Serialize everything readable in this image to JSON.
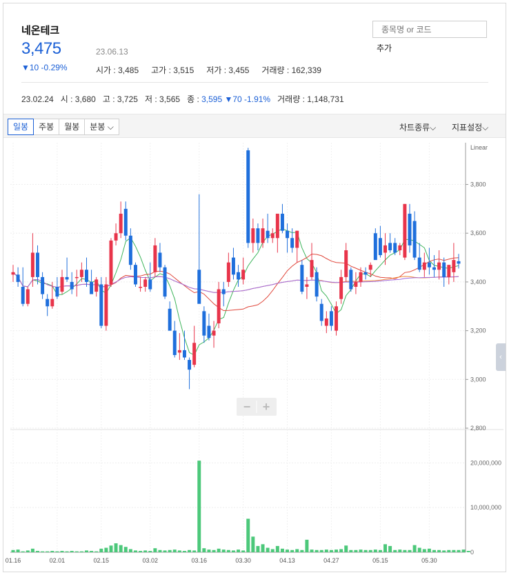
{
  "stock": {
    "name": "네온테크",
    "price": "3,475",
    "change": "▼10 -0.29%",
    "date": "23.06.13",
    "open_label": "시가",
    "open": "3,485",
    "high_label": "고가",
    "high": "3,515",
    "low_label": "저가",
    "low": "3,455",
    "volume_label": "거래량",
    "volume": "162,339"
  },
  "search": {
    "placeholder": "종목명 or 코드",
    "add_label": "추가"
  },
  "prev_day": {
    "date": "23.02.24",
    "open_label": "시",
    "open": "3,680",
    "high_label": "고",
    "high": "3,725",
    "low_label": "저",
    "low": "3,565",
    "close_label": "종",
    "close": "3,595",
    "change": "▼70 -1.91%",
    "volume_label": "거래량",
    "volume": "1,148,731"
  },
  "toolbar": {
    "periods": [
      "일봉",
      "주봉",
      "월봉",
      "분봉"
    ],
    "active_period": "일봉",
    "chart_type_label": "차트종류",
    "indicator_label": "지표설정"
  },
  "colors": {
    "up": "#e8344a",
    "down": "#1f6fdc",
    "ma5": "#3db45a",
    "ma20": "#e0463a",
    "ma60": "#ef8a3c",
    "ma120": "#a06ae0",
    "volume": "#4cc87a"
  },
  "chart_data": {
    "type": "candlestick",
    "scale_label": "Linear",
    "price_axis": {
      "ylim": [
        2800,
        3960
      ],
      "ticks": [
        "3,800",
        "3,600",
        "3,400",
        "3,200",
        "3,000",
        "2,800"
      ]
    },
    "volume_axis": {
      "ylim": [
        0,
        27000000
      ],
      "ticks": [
        "20,000,000",
        "10,000,000",
        "0"
      ]
    },
    "x_ticks": [
      "01.16",
      "02.01",
      "02.15",
      "03.02",
      "03.16",
      "03.30",
      "04.13",
      "04.27",
      "05.15",
      "05.30"
    ],
    "zoom_controls": [
      "−",
      "+"
    ],
    "candles": [
      {
        "o": 3430,
        "h": 3470,
        "l": 3400,
        "c": 3440
      },
      {
        "o": 3430,
        "h": 3460,
        "l": 3380,
        "c": 3400
      },
      {
        "o": 3380,
        "h": 3460,
        "l": 3300,
        "c": 3310
      },
      {
        "o": 3310,
        "h": 3380,
        "l": 3300,
        "c": 3370
      },
      {
        "o": 3420,
        "h": 3600,
        "l": 3380,
        "c": 3520
      },
      {
        "o": 3520,
        "h": 3550,
        "l": 3390,
        "c": 3420
      },
      {
        "o": 3420,
        "h": 3440,
        "l": 3330,
        "c": 3350
      },
      {
        "o": 3330,
        "h": 3350,
        "l": 3260,
        "c": 3300
      },
      {
        "o": 3300,
        "h": 3400,
        "l": 3290,
        "c": 3330
      },
      {
        "o": 3380,
        "h": 3420,
        "l": 3330,
        "c": 3340
      },
      {
        "o": 3360,
        "h": 3450,
        "l": 3350,
        "c": 3420
      },
      {
        "o": 3420,
        "h": 3500,
        "l": 3400,
        "c": 3410
      },
      {
        "o": 3400,
        "h": 3440,
        "l": 3350,
        "c": 3370
      },
      {
        "o": 3420,
        "h": 3450,
        "l": 3340,
        "c": 3420
      },
      {
        "o": 3420,
        "h": 3480,
        "l": 3400,
        "c": 3450
      },
      {
        "o": 3450,
        "h": 3500,
        "l": 3380,
        "c": 3400
      },
      {
        "o": 3400,
        "h": 3450,
        "l": 3360,
        "c": 3350
      },
      {
        "o": 3360,
        "h": 3420,
        "l": 3340,
        "c": 3410
      },
      {
        "o": 3390,
        "h": 3420,
        "l": 3210,
        "c": 3220
      },
      {
        "o": 3220,
        "h": 3420,
        "l": 3200,
        "c": 3390
      },
      {
        "o": 3390,
        "h": 3580,
        "l": 3380,
        "c": 3570
      },
      {
        "o": 3570,
        "h": 3640,
        "l": 3550,
        "c": 3600
      },
      {
        "o": 3600,
        "h": 3730,
        "l": 3580,
        "c": 3680
      },
      {
        "o": 3700,
        "h": 3730,
        "l": 3570,
        "c": 3590
      },
      {
        "o": 3590,
        "h": 3620,
        "l": 3450,
        "c": 3470
      },
      {
        "o": 3470,
        "h": 3480,
        "l": 3380,
        "c": 3390
      },
      {
        "o": 3380,
        "h": 3420,
        "l": 3360,
        "c": 3380
      },
      {
        "o": 3380,
        "h": 3420,
        "l": 3360,
        "c": 3410
      },
      {
        "o": 3410,
        "h": 3480,
        "l": 3360,
        "c": 3370
      },
      {
        "o": 3440,
        "h": 3580,
        "l": 3420,
        "c": 3550
      },
      {
        "o": 3520,
        "h": 3560,
        "l": 3440,
        "c": 3460
      },
      {
        "o": 3460,
        "h": 3470,
        "l": 3330,
        "c": 3340
      },
      {
        "o": 3290,
        "h": 3320,
        "l": 3200,
        "c": 3200
      },
      {
        "o": 3200,
        "h": 3240,
        "l": 3090,
        "c": 3100
      },
      {
        "o": 3110,
        "h": 3190,
        "l": 3080,
        "c": 3120
      },
      {
        "o": 3120,
        "h": 3200,
        "l": 3080,
        "c": 3090
      },
      {
        "o": 3080,
        "h": 3090,
        "l": 2960,
        "c": 3040
      },
      {
        "o": 3060,
        "h": 3220,
        "l": 3050,
        "c": 3150
      },
      {
        "o": 3450,
        "h": 3760,
        "l": 3330,
        "c": 3310
      },
      {
        "o": 3280,
        "h": 3300,
        "l": 3150,
        "c": 3180
      },
      {
        "o": 3220,
        "h": 3270,
        "l": 3160,
        "c": 3170
      },
      {
        "o": 3180,
        "h": 3240,
        "l": 3130,
        "c": 3200
      },
      {
        "o": 3230,
        "h": 3400,
        "l": 3210,
        "c": 3370
      },
      {
        "o": 3370,
        "h": 3400,
        "l": 3300,
        "c": 3350
      },
      {
        "o": 3400,
        "h": 3520,
        "l": 3380,
        "c": 3480
      },
      {
        "o": 3500,
        "h": 3540,
        "l": 3410,
        "c": 3430
      },
      {
        "o": 3440,
        "h": 3470,
        "l": 3380,
        "c": 3410
      },
      {
        "o": 3410,
        "h": 3500,
        "l": 3390,
        "c": 3450
      },
      {
        "o": 3940,
        "h": 3950,
        "l": 3540,
        "c": 3560
      },
      {
        "o": 3560,
        "h": 3660,
        "l": 3520,
        "c": 3620
      },
      {
        "o": 3620,
        "h": 3640,
        "l": 3530,
        "c": 3560
      },
      {
        "o": 3560,
        "h": 3660,
        "l": 3540,
        "c": 3620
      },
      {
        "o": 3610,
        "h": 3680,
        "l": 3560,
        "c": 3580
      },
      {
        "o": 3580,
        "h": 3620,
        "l": 3560,
        "c": 3600
      },
      {
        "o": 3580,
        "h": 3650,
        "l": 3520,
        "c": 3680
      },
      {
        "o": 3680,
        "h": 3720,
        "l": 3600,
        "c": 3610
      },
      {
        "o": 3610,
        "h": 3640,
        "l": 3520,
        "c": 3580
      },
      {
        "o": 3580,
        "h": 3620,
        "l": 3520,
        "c": 3540
      },
      {
        "o": 3540,
        "h": 3610,
        "l": 3480,
        "c": 3610
      },
      {
        "o": 3470,
        "h": 3490,
        "l": 3350,
        "c": 3360
      },
      {
        "o": 3380,
        "h": 3420,
        "l": 3330,
        "c": 3390
      },
      {
        "o": 3420,
        "h": 3560,
        "l": 3410,
        "c": 3490
      },
      {
        "o": 3440,
        "h": 3460,
        "l": 3320,
        "c": 3340
      },
      {
        "o": 3310,
        "h": 3330,
        "l": 3220,
        "c": 3240
      },
      {
        "o": 3220,
        "h": 3280,
        "l": 3190,
        "c": 3250
      },
      {
        "o": 3280,
        "h": 3300,
        "l": 3200,
        "c": 3220
      },
      {
        "o": 3200,
        "h": 3320,
        "l": 3180,
        "c": 3300
      },
      {
        "o": 3330,
        "h": 3450,
        "l": 3310,
        "c": 3420
      },
      {
        "o": 3420,
        "h": 3560,
        "l": 3400,
        "c": 3530
      },
      {
        "o": 3450,
        "h": 3460,
        "l": 3360,
        "c": 3370
      },
      {
        "o": 3380,
        "h": 3440,
        "l": 3350,
        "c": 3400
      },
      {
        "o": 3400,
        "h": 3460,
        "l": 3380,
        "c": 3440
      },
      {
        "o": 3440,
        "h": 3460,
        "l": 3410,
        "c": 3430
      },
      {
        "o": 3450,
        "h": 3480,
        "l": 3420,
        "c": 3470
      },
      {
        "o": 3600,
        "h": 3620,
        "l": 3560,
        "c": 3490
      },
      {
        "o": 3580,
        "h": 3630,
        "l": 3500,
        "c": 3510
      },
      {
        "o": 3520,
        "h": 3600,
        "l": 3470,
        "c": 3550
      },
      {
        "o": 3560,
        "h": 3600,
        "l": 3520,
        "c": 3530
      },
      {
        "o": 3560,
        "h": 3580,
        "l": 3510,
        "c": 3520
      },
      {
        "o": 3530,
        "h": 3560,
        "l": 3510,
        "c": 3550
      },
      {
        "o": 3500,
        "h": 3720,
        "l": 3490,
        "c": 3720
      },
      {
        "o": 3680,
        "h": 3720,
        "l": 3520,
        "c": 3550
      },
      {
        "o": 3650,
        "h": 3690,
        "l": 3490,
        "c": 3500
      },
      {
        "o": 3500,
        "h": 3560,
        "l": 3440,
        "c": 3450
      },
      {
        "o": 3450,
        "h": 3520,
        "l": 3420,
        "c": 3480
      },
      {
        "o": 3480,
        "h": 3540,
        "l": 3430,
        "c": 3460
      },
      {
        "o": 3460,
        "h": 3510,
        "l": 3420,
        "c": 3450
      },
      {
        "o": 3450,
        "h": 3530,
        "l": 3410,
        "c": 3480
      },
      {
        "o": 3480,
        "h": 3500,
        "l": 3380,
        "c": 3420
      },
      {
        "o": 3420,
        "h": 3470,
        "l": 3390,
        "c": 3470
      },
      {
        "o": 3440,
        "h": 3560,
        "l": 3400,
        "c": 3490
      },
      {
        "o": 3485,
        "h": 3515,
        "l": 3455,
        "c": 3475
      }
    ],
    "volumes": [
      0.5,
      0.6,
      0.2,
      0.4,
      0.8,
      0.3,
      0.2,
      0.2,
      0.3,
      0.2,
      0.3,
      0.2,
      0.3,
      0.2,
      0.2,
      0.4,
      0.3,
      0.2,
      0.8,
      1.0,
      1.5,
      2.0,
      1.6,
      1.2,
      0.7,
      0.4,
      0.3,
      0.4,
      0.3,
      0.9,
      0.5,
      0.4,
      0.5,
      0.6,
      0.4,
      0.3,
      0.5,
      0.4,
      20.5,
      0.9,
      0.6,
      0.5,
      0.8,
      0.6,
      0.5,
      0.4,
      0.6,
      0.4,
      7.5,
      3.5,
      1.4,
      1.8,
      1.0,
      0.7,
      1.4,
      0.8,
      0.6,
      0.5,
      0.7,
      0.5,
      2.8,
      0.6,
      0.5,
      0.5,
      0.6,
      0.5,
      0.6,
      0.7,
      1.5,
      0.5,
      0.5,
      0.6,
      0.5,
      0.5,
      0.6,
      0.5,
      1.8,
      1.4,
      0.5,
      0.6,
      0.5,
      0.5,
      1.6,
      1.0,
      0.7,
      0.8,
      0.5,
      0.5,
      0.4,
      0.5,
      0.5,
      0.5,
      0.6,
      0.3
    ],
    "volume_unit": 1000000
  }
}
